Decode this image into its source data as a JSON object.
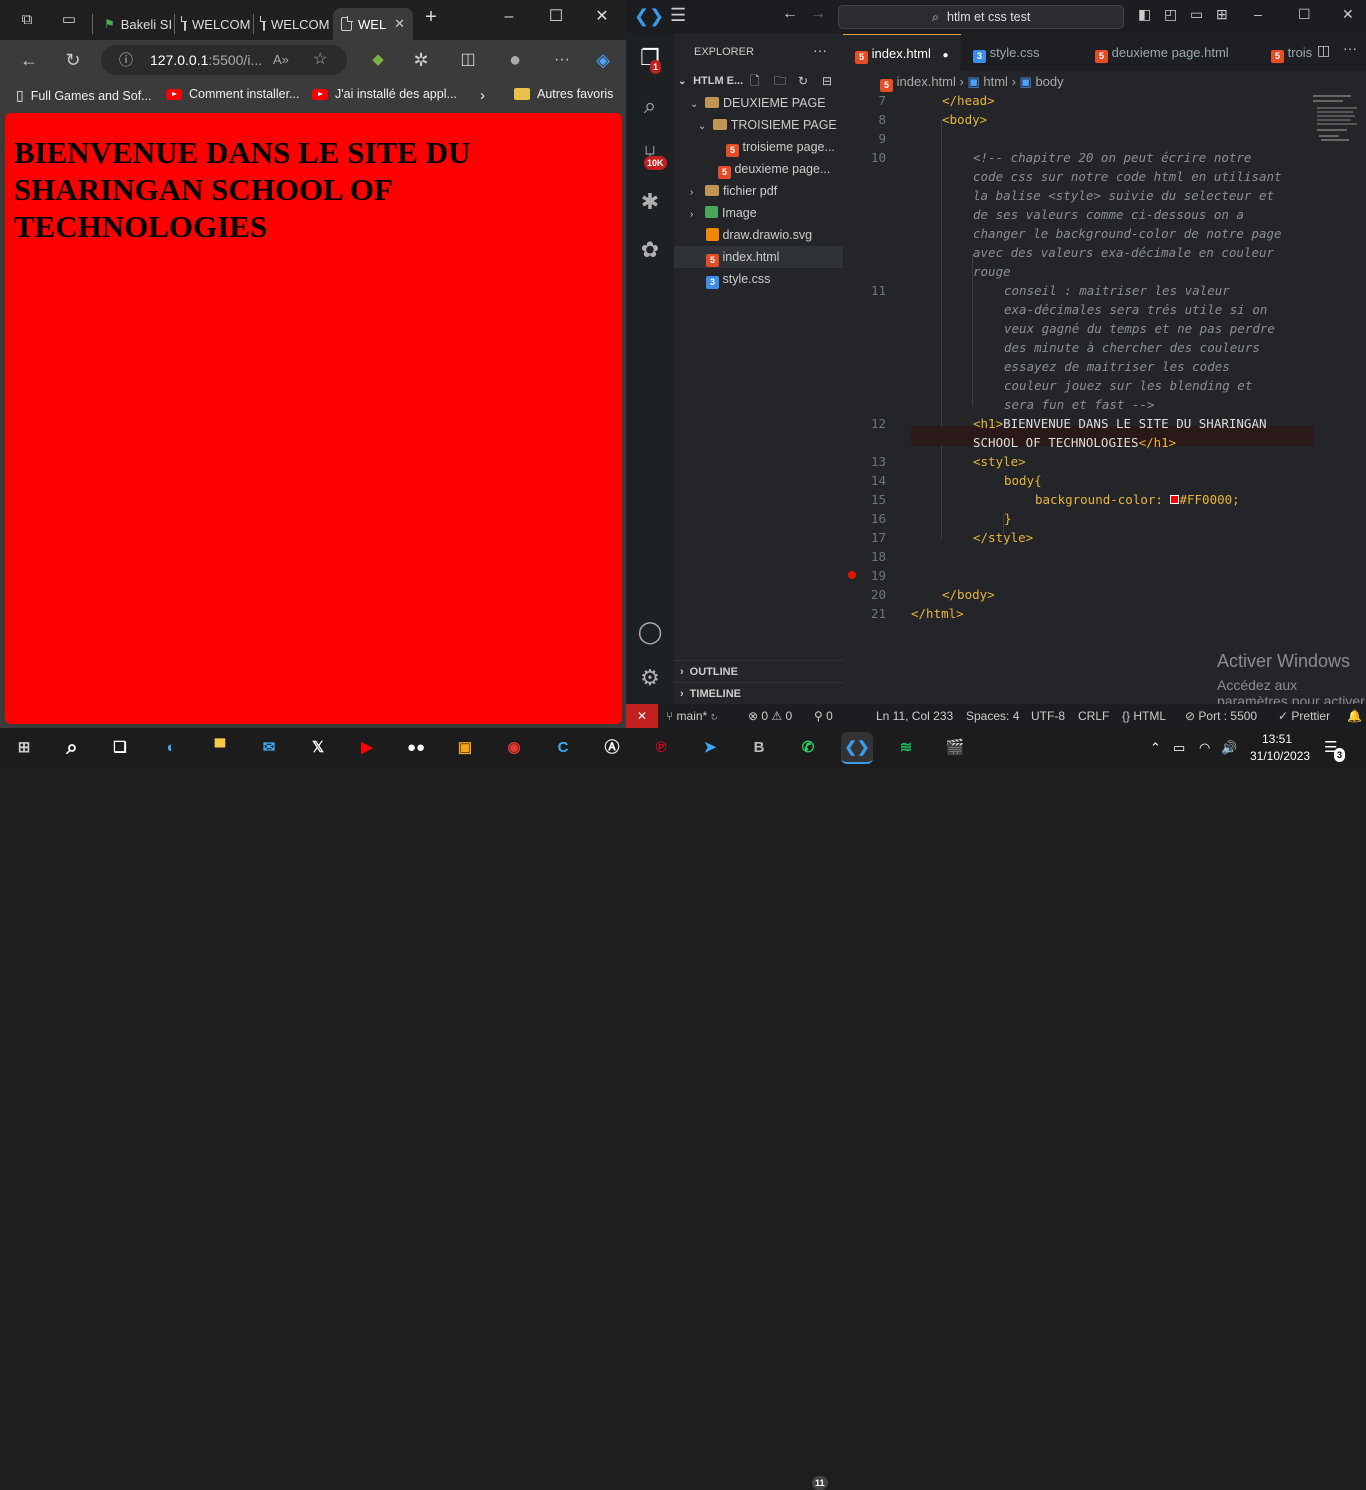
{
  "browser": {
    "tabs": [
      {
        "label": "Bakeli SI"
      },
      {
        "label": "WELCOM"
      },
      {
        "label": "WELCOM"
      },
      {
        "label": "WEL"
      }
    ],
    "new_tab_label": "+",
    "address": {
      "host": "127.0.0.1",
      "rest": ":5500/i..."
    },
    "bookmarks": [
      {
        "label": "Full Games and Sof..."
      },
      {
        "label": "Comment installer..."
      },
      {
        "label": "J'ai installé des appl..."
      }
    ],
    "other_favorites": "Autres favoris",
    "page": {
      "heading": "BIENVENUE DANS LE SITE DU SHARINGAN SCHOOL OF TECHNOLOGIES",
      "background": "#ff0000"
    }
  },
  "vscode": {
    "search": "htlm et css test",
    "activity": {
      "source_control_badge": "10K",
      "explorer_badge": "1"
    },
    "explorer": {
      "title": "EXPLORER",
      "project": "HTLM E...",
      "tree": [
        {
          "label": "DEUXIEME PAGE"
        },
        {
          "label": "TROISIEME PAGE"
        },
        {
          "label": "troisieme page..."
        },
        {
          "label": "deuxieme page..."
        },
        {
          "label": "fichier pdf"
        },
        {
          "label": "Image"
        },
        {
          "label": "draw.drawio.svg"
        },
        {
          "label": "index.html"
        },
        {
          "label": "style.css"
        }
      ],
      "outline": "OUTLINE",
      "timeline": "TIMELINE"
    },
    "tabs": [
      {
        "label": "index.html"
      },
      {
        "label": "style.css"
      },
      {
        "label": "deuxieme page.html"
      },
      {
        "label": "trois"
      }
    ],
    "breadcrumbs": {
      "file": "index.html",
      "html": "html",
      "body": "body"
    },
    "code": {
      "l7": "</head>",
      "l8": "<body>",
      "c1": "<!-- chapitre 20 on peut écrire notre",
      "c2": "code css sur notre code html en utilisant",
      "c3": "la balise <style> suivie du selecteur et",
      "c4": "de ses valeurs comme ci-dessous on a",
      "c5": "changer le background-color de notre page",
      "c6": "avec des valeurs exa-décimale en couleur",
      "c7": "rouge",
      "c8": "conseil : maitriser les valeur",
      "c9": "exa-décimales sera trés utile si on",
      "c10": "veux gagné du temps et ne pas perdre",
      "c11": "des minute à chercher des couleurs",
      "c12": "essayez de maitriser les codes",
      "c13": "couleur jouez sur les blending et",
      "c14": "sera fun et fast -->",
      "h1open": "<h1>",
      "h1a": "BIENVENUE DANS LE SITE DU SHARINGAN",
      "h1b": "SCHOOL OF TECHNOLOGIES",
      "h1close": "</h1>",
      "style_open": "<style>",
      "body_sel": "body{",
      "bg_prop": "background-color:",
      "bg_val": "#FF0000;",
      "brace": "}",
      "style_close": "</style>",
      "body_close": "</body>",
      "html_close": "</html>"
    },
    "line_numbers": [
      "7",
      "8",
      "9",
      "10",
      "11",
      "12",
      "13",
      "14",
      "15",
      "16",
      "17",
      "18",
      "19",
      "20",
      "21"
    ],
    "watermark": {
      "title": "Activer Windows",
      "sub": "Accédez aux paramètres pour activer Windows."
    },
    "status": {
      "branch": "main*",
      "errors": "0",
      "warnings": "0",
      "ports": "0",
      "position": "Ln 11, Col 233",
      "spaces": "Spaces: 4",
      "encoding": "UTF-8",
      "eol": "CRLF",
      "language": "HTML",
      "port": "Port : 5500",
      "prettier": "Prettier"
    }
  },
  "taskbar": {
    "time": "13:51",
    "date": "31/10/2023",
    "notifications": "3",
    "whatsapp_badge": "11"
  }
}
